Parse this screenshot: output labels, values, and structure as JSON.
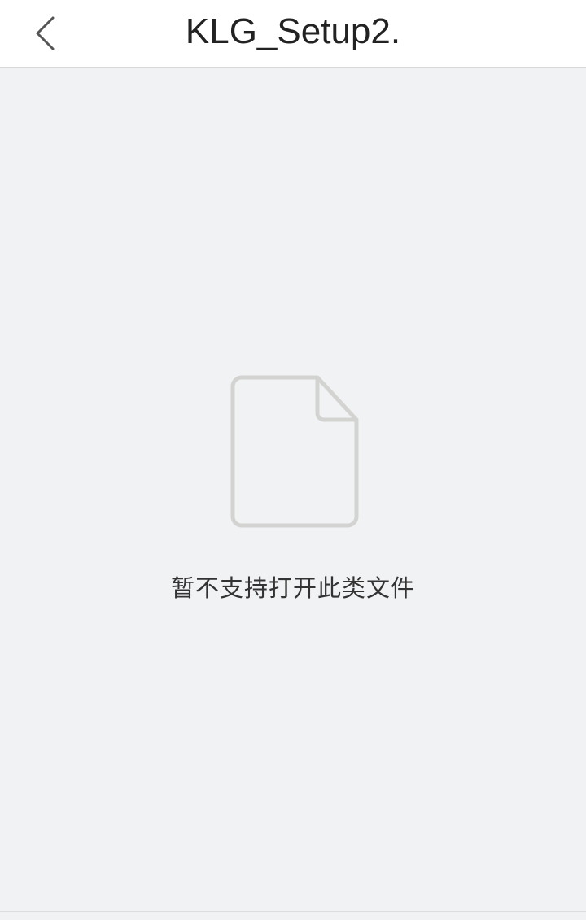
{
  "nav": {
    "title": "KLG_Setup2.",
    "back_icon": "chevron-left-icon"
  },
  "content": {
    "file_icon": "document-icon",
    "message": "暂不支持打开此类文件"
  },
  "colors": {
    "background": "#f1f2f4",
    "nav_background": "#ffffff",
    "icon_stroke": "#d3d4d2",
    "text": "#333333"
  }
}
